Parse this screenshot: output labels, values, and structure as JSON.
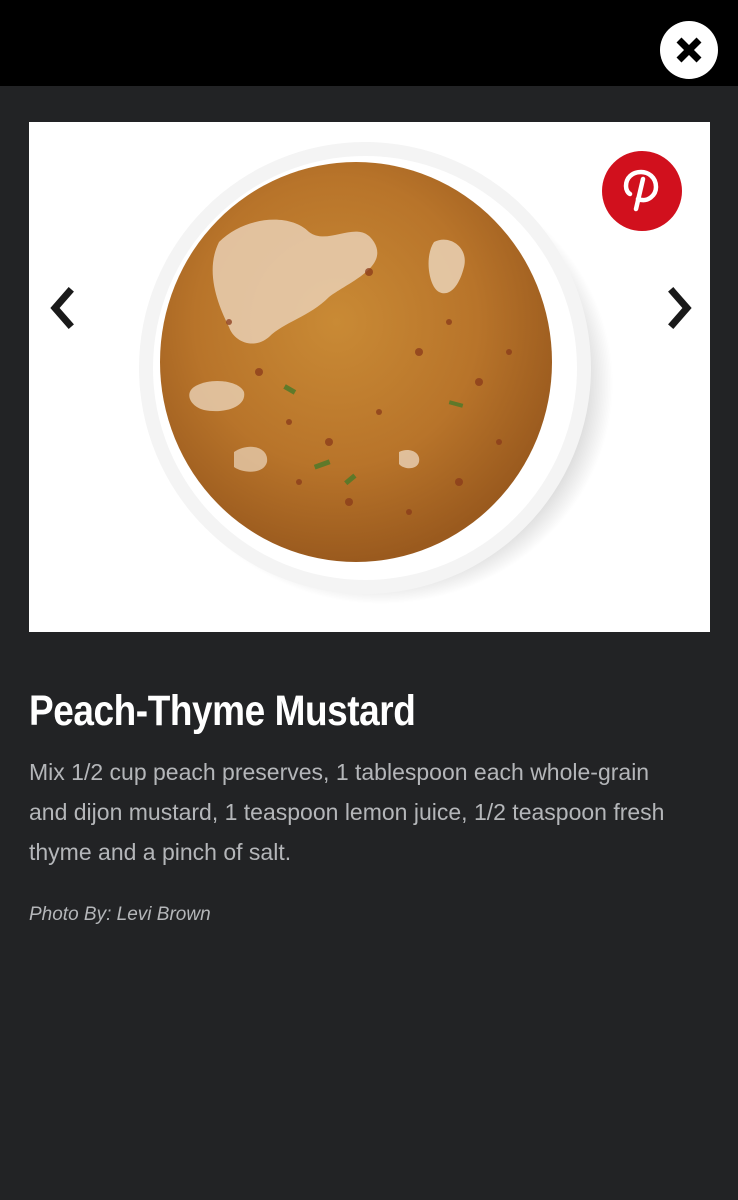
{
  "window": {
    "close_icon": "close-icon"
  },
  "slide": {
    "image_subject": "bowl of peach-thyme mustard sauce",
    "prev_icon": "chevron-left-icon",
    "next_icon": "chevron-right-icon",
    "pin_icon": "pinterest-icon",
    "title": "Peach-Thyme Mustard",
    "description": "Mix 1/2 cup peach preserves, 1 tablespoon each whole-grain and dijon mustard, 1 teaspoon lemon juice, 1/2 teaspoon fresh thyme and a pinch of salt.",
    "credit": "Photo By: Levi Brown"
  },
  "colors": {
    "page_background": "#222325",
    "top_bar": "#000000",
    "pinterest_red": "#d1101d",
    "sauce": "#b8742a",
    "text_primary": "#ffffff",
    "text_secondary": "#b4b6b9"
  }
}
